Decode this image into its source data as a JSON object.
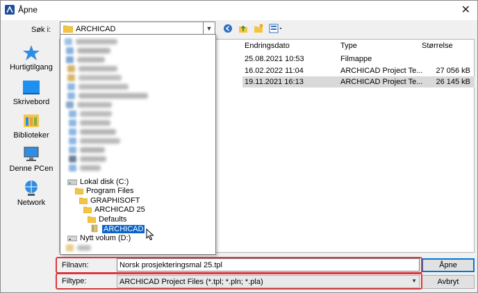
{
  "title": "Åpne",
  "close_glyph": "✕",
  "look_in": {
    "label": "Søk i:",
    "value": "ARCHICAD"
  },
  "places": [
    {
      "label": "Hurtigtilgang",
      "icon": "star-icon"
    },
    {
      "label": "Skrivebord",
      "icon": "desktop-icon"
    },
    {
      "label": "Biblioteker",
      "icon": "libraries-icon"
    },
    {
      "label": "Denne PCen",
      "icon": "computer-icon"
    },
    {
      "label": "Network",
      "icon": "network-icon"
    }
  ],
  "columns": {
    "date": "Endringsdato",
    "type": "Type",
    "size": "Størrelse"
  },
  "files": [
    {
      "date": "25.08.2021 10:53",
      "type": "Filmappe",
      "size": ""
    },
    {
      "date": "16.02.2022 11:04",
      "type": "ARCHICAD Project Te...",
      "size": "27 056 kB"
    },
    {
      "date": "19.11.2021 16:13",
      "type": "ARCHICAD Project Te...",
      "size": "26 145 kB"
    }
  ],
  "tree": [
    {
      "label": "Lokal disk (C:)",
      "icon": "drive-icon"
    },
    {
      "label": "Program Files",
      "icon": "folder-icon"
    },
    {
      "label": "GRAPHISOFT",
      "icon": "folder-icon"
    },
    {
      "label": "ARCHICAD 25",
      "icon": "folder-icon"
    },
    {
      "label": "Defaults",
      "icon": "folder-icon"
    },
    {
      "label": "ARCHICAD",
      "icon": "folder-open-icon"
    },
    {
      "label": "Nytt volum (D:)",
      "icon": "drive-icon"
    }
  ],
  "filename": {
    "label": "Filnavn:",
    "value": "Norsk prosjekteringsmal 25.tpl"
  },
  "filetype": {
    "label": "Filtype:",
    "value": "ARCHICAD Project Files (*.tpl; *.pln; *.pla)"
  },
  "buttons": {
    "open": "Åpne",
    "cancel": "Avbryt"
  },
  "colors": {
    "selection": "#0a64c8",
    "highlight": "#d9363e",
    "folder": "#f4c542"
  }
}
